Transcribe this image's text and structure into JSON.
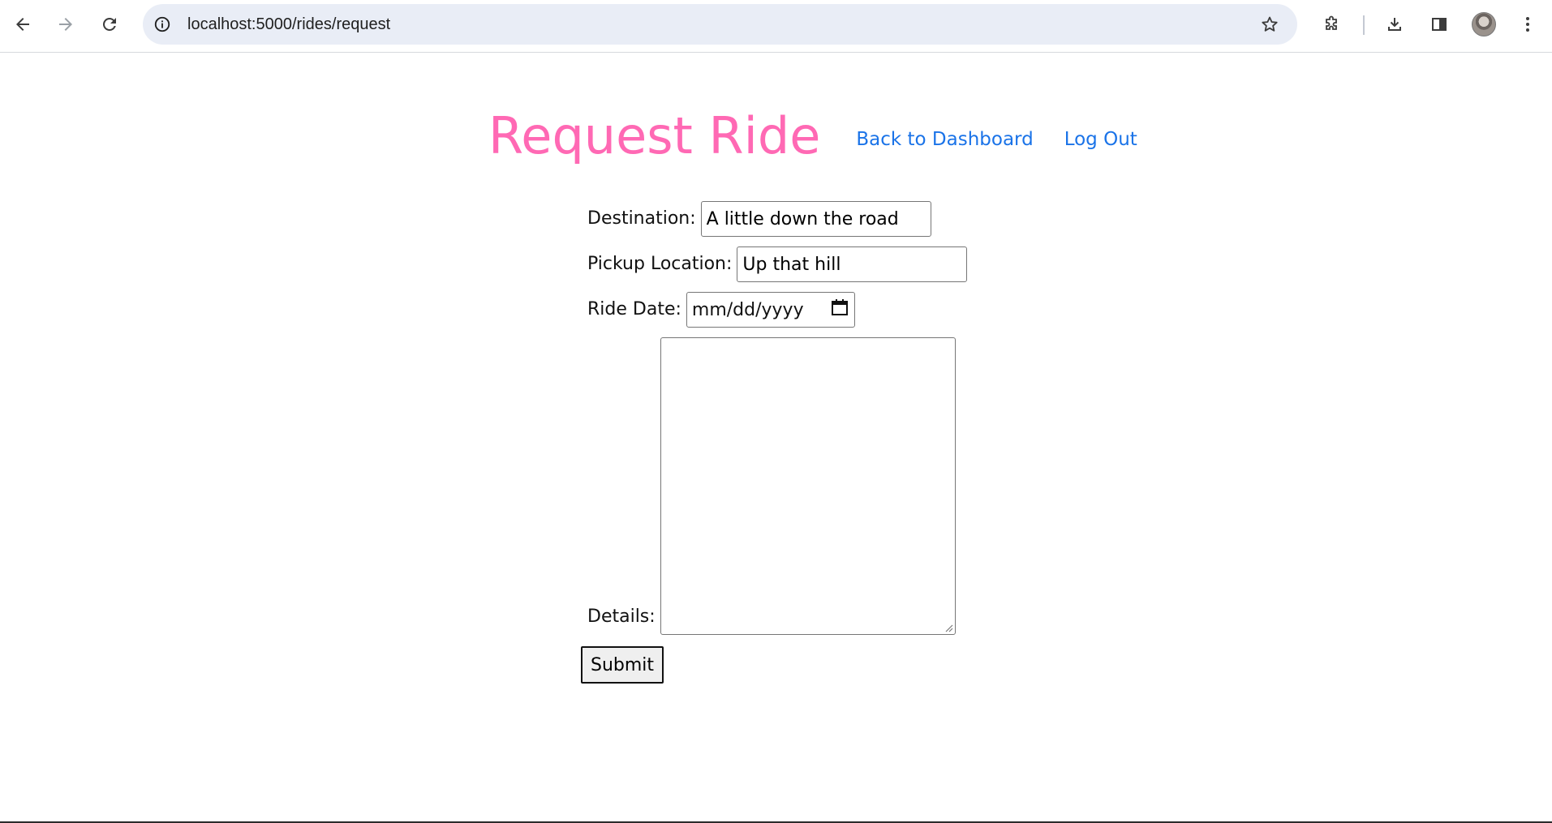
{
  "browser": {
    "url": "localhost:5000/rides/request",
    "icons": [
      "back-arrow-icon",
      "forward-arrow-icon",
      "reload-icon",
      "site-info-icon",
      "bookmark-star-icon",
      "extensions-icon",
      "downloads-icon",
      "side-panel-icon",
      "profile-avatar",
      "menu-kebab-icon"
    ]
  },
  "header": {
    "title": "Request Ride",
    "links": {
      "dashboard": "Back to Dashboard",
      "logout": "Log Out"
    }
  },
  "form": {
    "destination": {
      "label": "Destination:",
      "value": "A little down the road"
    },
    "pickup": {
      "label": "Pickup Location:",
      "value": "Up that hill"
    },
    "ride_date": {
      "label": "Ride Date:",
      "placeholder": "mm/dd/yyyy"
    },
    "details": {
      "label": "Details:",
      "value": ""
    },
    "submit_label": "Submit"
  },
  "colors": {
    "title": "#ff69b4",
    "link": "#1a73e8",
    "omnibox_bg": "#e9edf6"
  }
}
